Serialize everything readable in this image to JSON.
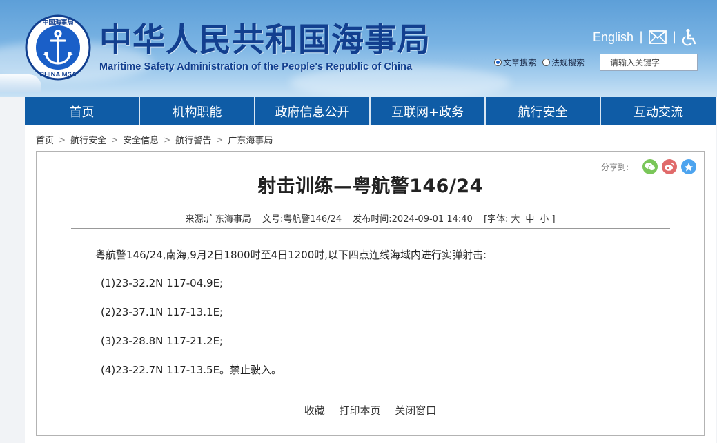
{
  "header": {
    "title_cn": "中华人民共和国海事局",
    "title_en": "Maritime Safety Administration of the People's Republic of China",
    "logo": {
      "name": "china-msa-logo",
      "text_top": "中国海事局",
      "text_bottom": "CHINA MSA"
    },
    "english_link": "English",
    "mail_icon": "mail-icon",
    "accessibility_icon": "accessibility-icon",
    "search": {
      "option_article": "文章搜索",
      "option_law": "法规搜索",
      "selected": "文章搜索",
      "placeholder": "请输入关键字"
    }
  },
  "nav": {
    "items": [
      {
        "label": "首页"
      },
      {
        "label": "机构职能"
      },
      {
        "label": "政府信息公开"
      },
      {
        "label": "互联网+政务"
      },
      {
        "label": "航行安全"
      },
      {
        "label": "互动交流"
      }
    ]
  },
  "breadcrumb": [
    "首页",
    "航行安全",
    "安全信息",
    "航行警告",
    "广东海事局"
  ],
  "share": {
    "label": "分享到:",
    "icons": [
      "wechat-icon",
      "weibo-icon",
      "qzone-icon"
    ],
    "colors": [
      "#7ac659",
      "#e06a6a",
      "#4da4ef"
    ]
  },
  "article": {
    "title": "射击训练—粤航警146/24",
    "meta": {
      "source": "来源:广东海事局",
      "doc_no": "文号:粤航警146/24",
      "published": "发布时间:2024-09-01 14:40",
      "font_label": "[字体:",
      "font_large": "大",
      "font_medium": "中",
      "font_small": "小",
      "font_end": "]"
    },
    "intro": "粤航警146/24,南海,9月2日1800时至4日1200时,以下四点连线海域内进行实弹射击:",
    "coords": [
      "(1)23-32.2N 117-04.9E;",
      "(2)23-37.1N 117-13.1E;",
      "(3)23-28.8N 117-21.2E;",
      "(4)23-22.7N 117-13.5E。禁止驶入。"
    ],
    "actions": {
      "favorite": "收藏",
      "print": "打印本页",
      "close": "关闭窗口"
    }
  },
  "colors": {
    "nav_bg": "#0f5ca6",
    "title_blue": "#123f8f"
  }
}
